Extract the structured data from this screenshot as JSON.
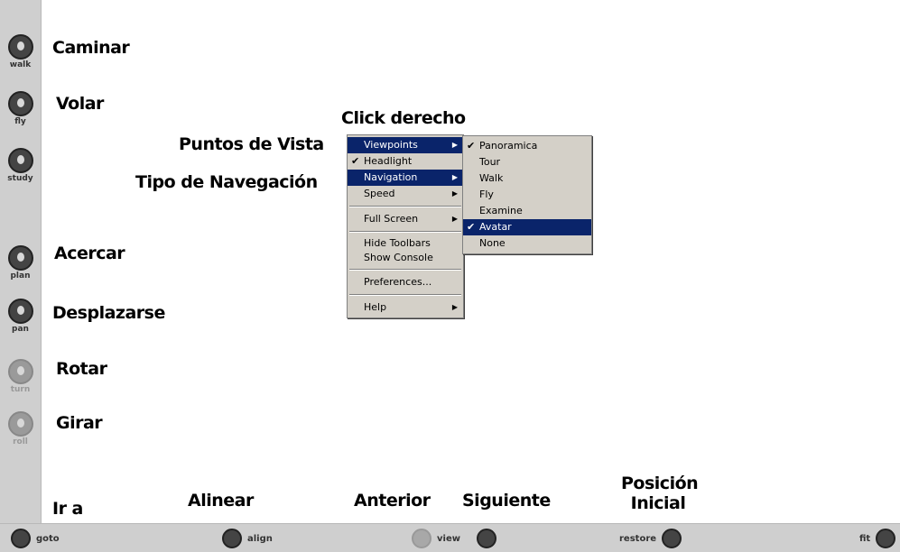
{
  "left_toolbar": [
    {
      "name": "walk",
      "label": "walk",
      "annotation": "Caminar"
    },
    {
      "name": "fly",
      "label": "fly",
      "annotation": "Volar"
    },
    {
      "name": "study",
      "label": "study",
      "annotation": ""
    },
    {
      "name": "plan",
      "label": "plan",
      "annotation": "Acercar"
    },
    {
      "name": "pan",
      "label": "pan",
      "annotation": "Desplazarse"
    },
    {
      "name": "turn",
      "label": "turn",
      "annotation": "Rotar"
    },
    {
      "name": "roll",
      "label": "roll",
      "annotation": "Girar"
    }
  ],
  "bottom_toolbar": {
    "goto": "goto",
    "align": "align",
    "view": "view",
    "restore": "restore",
    "fit": "fit"
  },
  "annotations": {
    "click_derecho": "Click derecho",
    "puntos_de_vista": "Puntos de Vista",
    "tipo_de_navegacion": "Tipo de Navegación",
    "ir_a": "Ir a",
    "alinear": "Alinear",
    "anterior": "Anterior",
    "siguiente": "Siguiente",
    "posicion_inicial_1": "Posición",
    "posicion_inicial_2": "Inicial"
  },
  "context_menu": {
    "viewpoints": "Viewpoints",
    "headlight": "Headlight",
    "navigation": "Navigation",
    "speed": "Speed",
    "full_screen": "Full Screen",
    "hide_toolbars": "Hide Toolbars",
    "show_console": "Show Console",
    "preferences": "Preferences...",
    "help": "Help"
  },
  "navigation_submenu": {
    "panoramica": "Panoramica",
    "tour": "Tour",
    "walk": "Walk",
    "fly": "Fly",
    "examine": "Examine",
    "avatar": "Avatar",
    "none": "None"
  },
  "glyphs": {
    "check": "✔",
    "arrow": "▶"
  }
}
